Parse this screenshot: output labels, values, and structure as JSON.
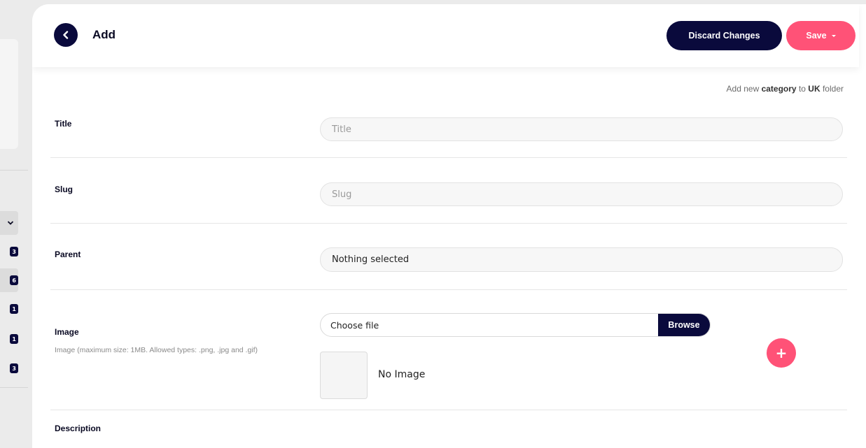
{
  "sidebar": {
    "badges": [
      "3",
      "6",
      "1",
      "1",
      "3"
    ]
  },
  "header": {
    "title": "Add",
    "discard_label": "Discard Changes",
    "save_label": "Save"
  },
  "hint": {
    "prefix": "Add new ",
    "entity": "category",
    "middle": " to ",
    "folder": "UK",
    "suffix": " folder"
  },
  "form": {
    "title": {
      "label": "Title",
      "placeholder": "Title",
      "value": ""
    },
    "slug": {
      "label": "Slug",
      "placeholder": "Slug",
      "value": ""
    },
    "parent": {
      "label": "Parent",
      "selected": "Nothing selected"
    },
    "image": {
      "label": "Image",
      "help": "Image (maximum size: 1MB. Allowed types: .png, .jpg and .gif)",
      "file_text": "Choose file",
      "browse_label": "Browse",
      "no_image_text": "No Image",
      "add_label": "+"
    },
    "description": {
      "label": "Description"
    }
  },
  "colors": {
    "navy": "#0a0a3c",
    "accent": "#ff5277"
  }
}
